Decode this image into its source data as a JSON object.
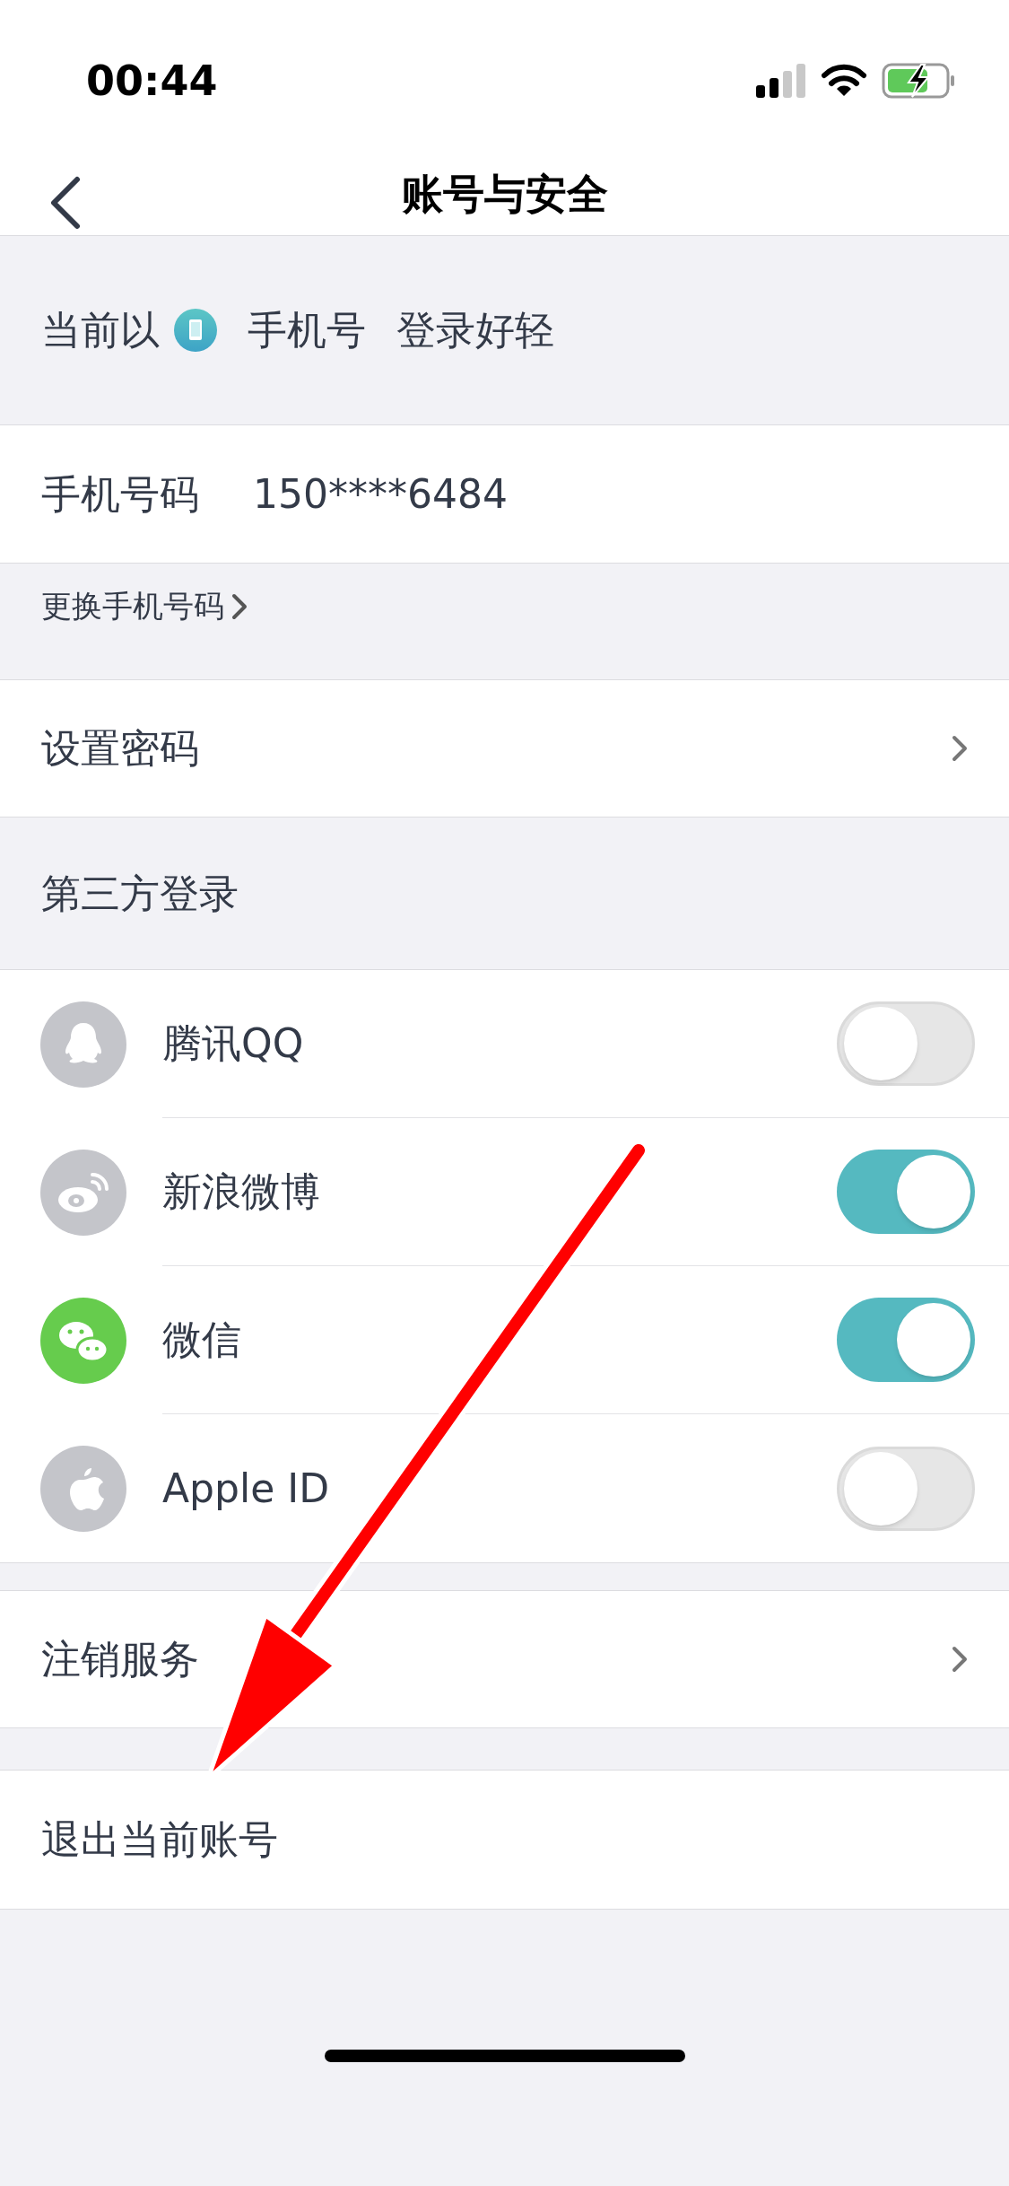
{
  "status_bar": {
    "time": "00:44"
  },
  "nav": {
    "title": "账号与安全"
  },
  "login_info": {
    "prefix": "当前以",
    "method": "手机号",
    "suffix": "登录好轻"
  },
  "phone": {
    "label": "手机号码",
    "value": "150****6484"
  },
  "change_phone": {
    "label": "更换手机号码"
  },
  "set_password": {
    "label": "设置密码"
  },
  "third_party": {
    "title": "第三方登录",
    "accounts": [
      {
        "kind": "qq",
        "label": "腾讯QQ",
        "on": false
      },
      {
        "kind": "weibo",
        "label": "新浪微博",
        "on": true
      },
      {
        "kind": "wechat",
        "label": "微信",
        "on": true
      },
      {
        "kind": "apple",
        "label": "Apple ID",
        "on": false
      }
    ]
  },
  "cancel_service": {
    "label": "注销服务"
  },
  "logout": {
    "label": "退出当前账号"
  }
}
